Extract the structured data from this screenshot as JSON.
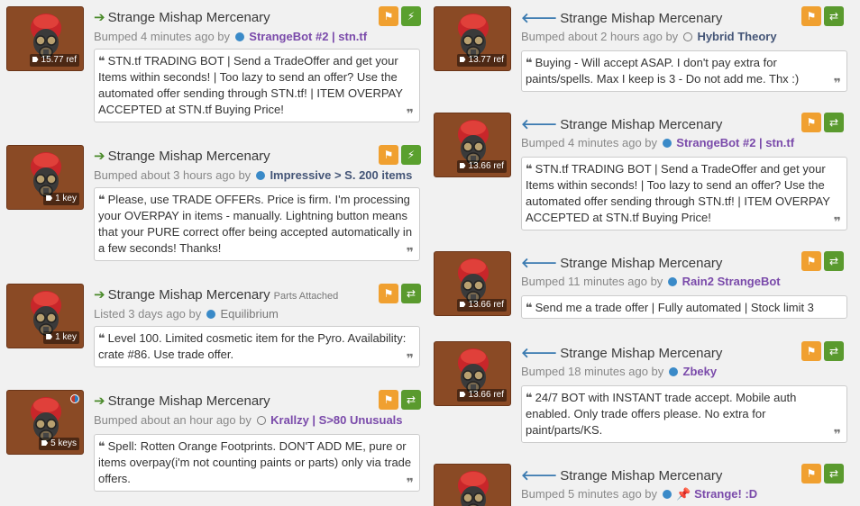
{
  "listings": [
    {
      "title": "Strange Mishap Mercenary",
      "subtitle": "",
      "price": "15.77 ref",
      "action": "Bumped 4 minutes ago by",
      "user": "StrangeBot #2 | stn.tf",
      "comment": "STN.tf TRADING BOT | Send a TradeOffer and get your Items within seconds! | Too lazy to send an offer? Use the automated offer sending through STN.tf! | ITEM OVERPAY ACCEPTED at STN.tf Buying Price!"
    },
    {
      "title": "Strange Mishap Mercenary",
      "subtitle": "",
      "price": "1 key",
      "action": "Bumped about 3 hours ago by",
      "user": "Impressive > S. 200 items",
      "comment": "Please, use TRADE OFFERs. Price is firm. I'm processing your OVERPAY in items - manually. Lightning button means that your PURE correct offer being accepted automatically in a few seconds! Thanks!"
    },
    {
      "title": "Strange Mishap Mercenary",
      "subtitle": "Parts Attached",
      "price": "1 key",
      "action": "Listed 3 days ago by",
      "user": "Equilibrium",
      "comment": "Level 100. Limited cosmetic item for the Pyro. Availability: crate #86. Use trade offer."
    },
    {
      "title": "Strange Mishap Mercenary",
      "subtitle": "",
      "price": "5 keys",
      "action": "Bumped about an hour ago by",
      "user": "Krallzy | S>80 Unusuals",
      "comment": "Spell: Rotten Orange Footprints. DON'T ADD ME, pure or items overpay(i'm not counting paints or parts) only via trade offers."
    },
    {
      "title": "Strange Mishap Mercenary",
      "subtitle": "",
      "price": "13.77 ref",
      "action": "Bumped about 2 hours ago by",
      "user": "Hybrid Theory",
      "comment": "Buying - Will accept ASAP. I don't pay extra for paints/spells. Max I keep is 3 - Do not add me. Thx :)"
    },
    {
      "title": "Strange Mishap Mercenary",
      "subtitle": "",
      "price": "13.66 ref",
      "action": "Bumped 4 minutes ago by",
      "user": "StrangeBot #2 | stn.tf",
      "comment": "STN.tf TRADING BOT | Send a TradeOffer and get your Items within seconds! | Too lazy to send an offer? Use the automated offer sending through STN.tf! | ITEM OVERPAY ACCEPTED at STN.tf Buying Price!"
    },
    {
      "title": "Strange Mishap Mercenary",
      "subtitle": "",
      "price": "13.66 ref",
      "action": "Bumped 11 minutes ago by",
      "user": "Rain2 StrangeBot",
      "comment": "Send me a trade offer | Fully automated | Stock limit 3"
    },
    {
      "title": "Strange Mishap Mercenary",
      "subtitle": "",
      "price": "13.66 ref",
      "action": "Bumped 18 minutes ago by",
      "user": "Zbeky",
      "comment": "24/7 BOT with INSTANT trade accept. Mobile auth enabled. Only trade offers please. No extra for paint/parts/KS."
    },
    {
      "title": "Strange Mishap Mercenary",
      "subtitle": "",
      "price": "",
      "action": "Bumped 5 minutes ago by",
      "user": "Strange! :D",
      "comment": ""
    }
  ]
}
